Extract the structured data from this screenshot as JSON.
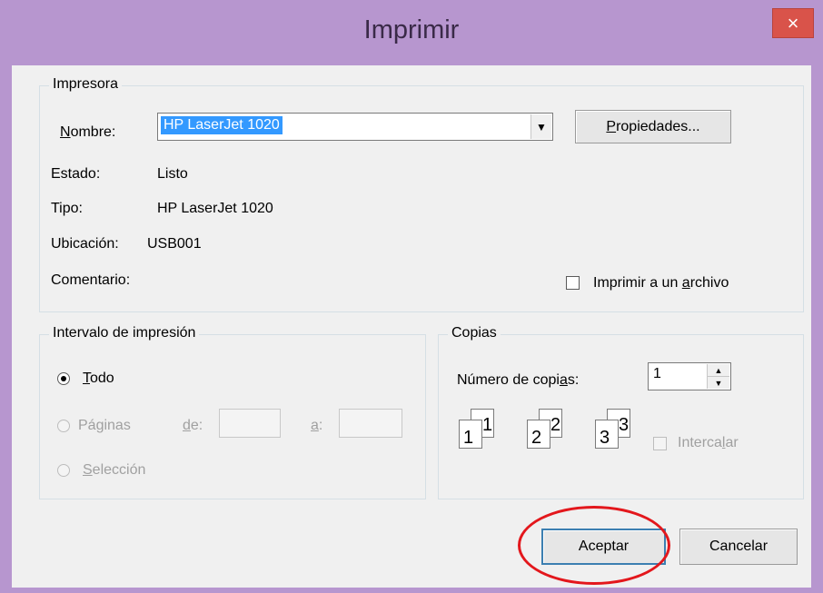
{
  "window": {
    "title": "Imprimir",
    "close_glyph": "×"
  },
  "printer": {
    "group_label": "Impresora",
    "name_label": "Nombre:",
    "name_value": "HP LaserJet 1020",
    "properties_button": "Propiedades...",
    "status_label": "Estado:",
    "status_value": "Listo",
    "type_label": "Tipo:",
    "type_value": "HP LaserJet 1020",
    "location_label": "Ubicación:",
    "location_value": "USB001",
    "comment_label": "Comentario:",
    "print_to_file_label": "Imprimir a un archivo",
    "print_to_file_checked": false
  },
  "range": {
    "group_label": "Intervalo de impresión",
    "all_label": "Todo",
    "pages_label": "Páginas",
    "from_label": "de:",
    "to_label": "a:",
    "from_value": "",
    "to_value": "",
    "selection_label": "Selección",
    "selected": "all"
  },
  "copies": {
    "group_label": "Copias",
    "count_label": "Número de copias:",
    "count_value": "1",
    "collate_label": "Intercalar",
    "collate_checked": false,
    "collate_icons": [
      "1",
      "1",
      "2",
      "2",
      "3",
      "3"
    ]
  },
  "actions": {
    "ok_label": "Aceptar",
    "cancel_label": "Cancelar"
  },
  "colors": {
    "title_bar": "#b796cf",
    "close_button": "#d9534a",
    "selection": "#3399ff",
    "highlight_ring": "#e3171c"
  }
}
